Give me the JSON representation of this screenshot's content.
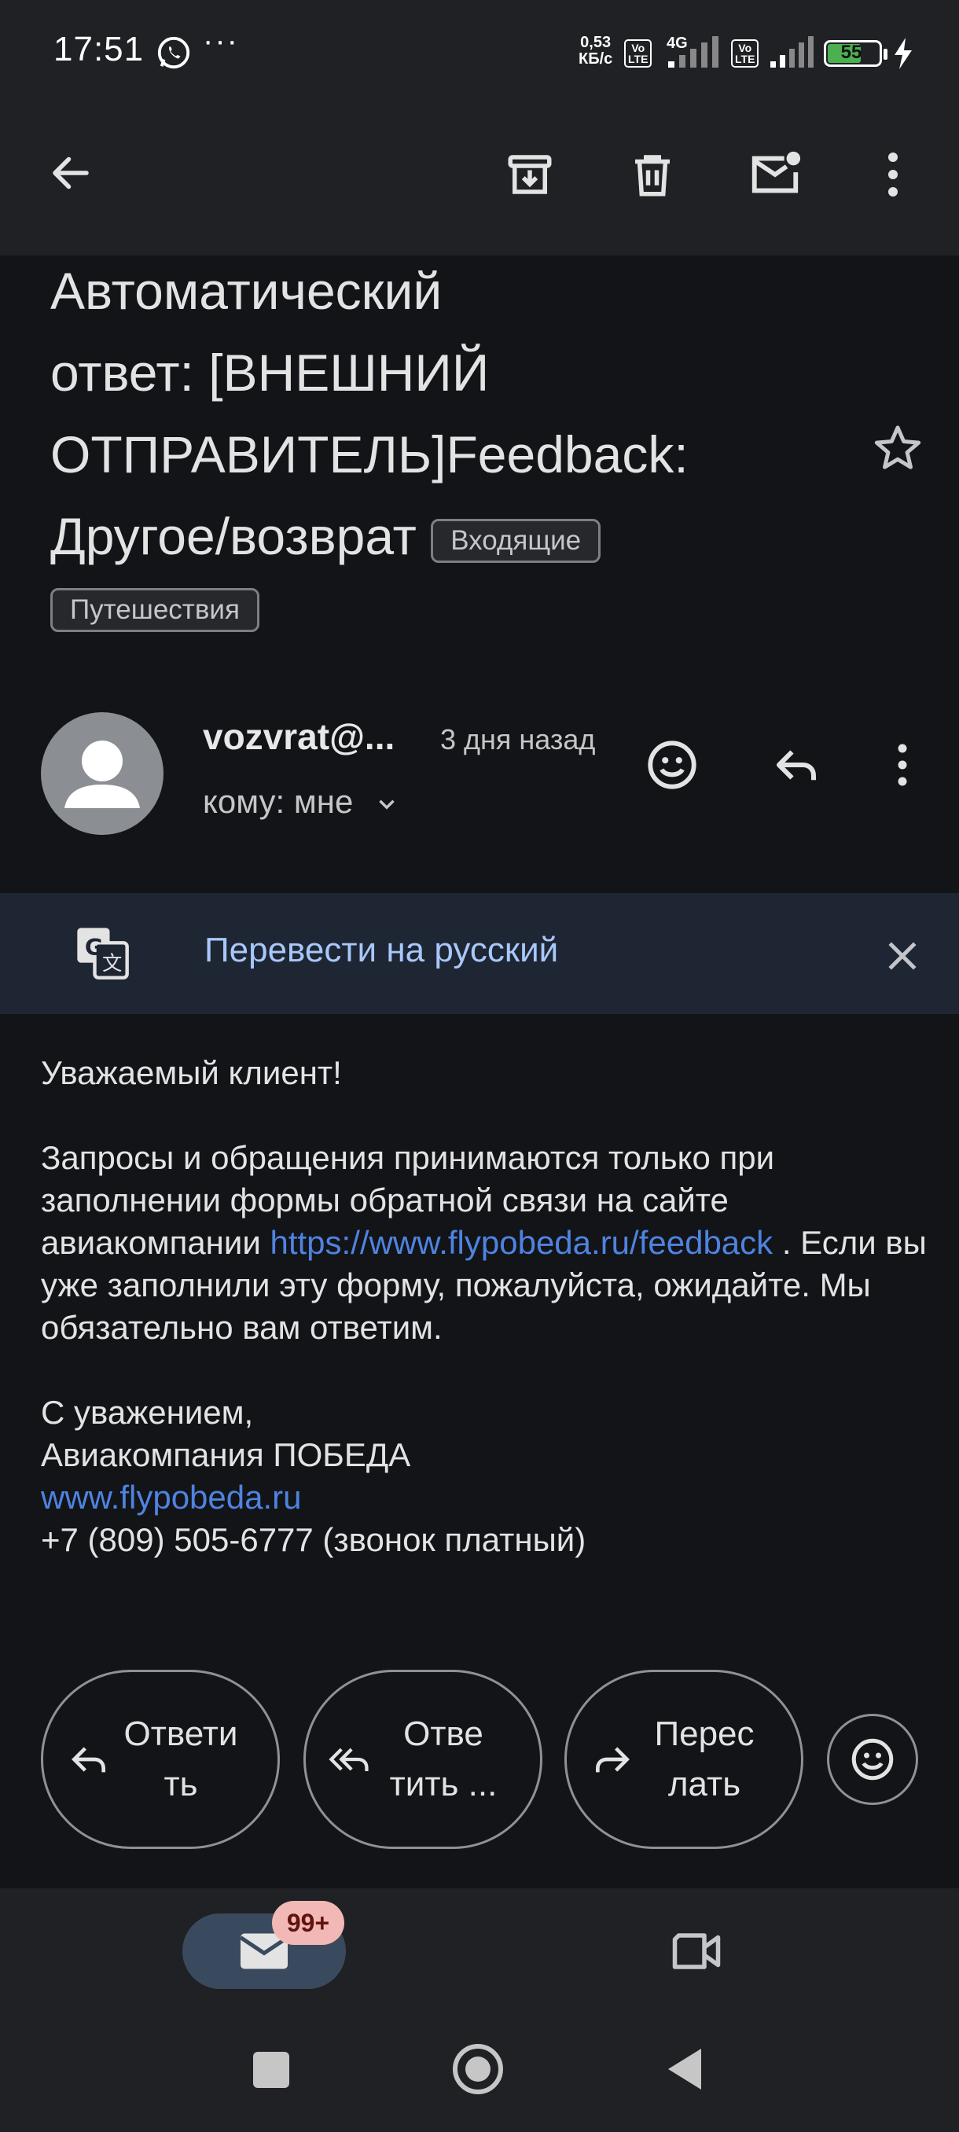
{
  "status_bar": {
    "time": "17:51",
    "net_speed_value": "0,53",
    "net_speed_unit": "КБ/с",
    "lte1": "Vo\nLTE",
    "network_type": "4G",
    "lte2": "Vo\nLTE",
    "battery": "55"
  },
  "toolbar": {
    "icons": [
      "back-arrow-icon",
      "archive-icon",
      "delete-icon",
      "mark-unread-icon",
      "more-vert-icon"
    ]
  },
  "email": {
    "subject_line1": "Автоматический",
    "subject_line2": "ответ: [ВНЕШНИЙ",
    "subject_line3": "ОТПРАВИТЕЛЬ]Feedback:",
    "subject_line4": "Другое/возврат",
    "label_inbox": "Входящие",
    "label_travel": "Путешествия",
    "sender": "vozvrat@...",
    "date": "3 дня назад",
    "recipient": "кому: мне"
  },
  "translate_banner": {
    "text": "Перевести на русский"
  },
  "body": {
    "greeting": "Уважаемый клиент!",
    "para_part1": "Запросы и обращения принимаются только при заполнении формы обратной связи на сайте авиакомпании ",
    "link_feedback": "https://www.flypobeda.ru/feedback",
    "para_part2": " . Если вы уже заполнили эту форму, пожалуйста, ожидайте. Мы обязательно вам ответим.",
    "regards": "С уважением,",
    "company": "Авиакомпания ПОБЕДА",
    "site_link": "www.flypobeda.ru",
    "phone": "+7 (809) 505-6777 (звонок платный)"
  },
  "actions": {
    "reply": "Ответи\nть",
    "reply_all": "Отве\nтить ...",
    "forward": "Перес\nлать"
  },
  "bottom_nav": {
    "mail_badge": "99+"
  },
  "colors": {
    "background": "#121418",
    "bar": "#1f2124",
    "link": "#4f83e0",
    "translate_text": "#a8c7fa",
    "badge": "#f2b8b5"
  }
}
